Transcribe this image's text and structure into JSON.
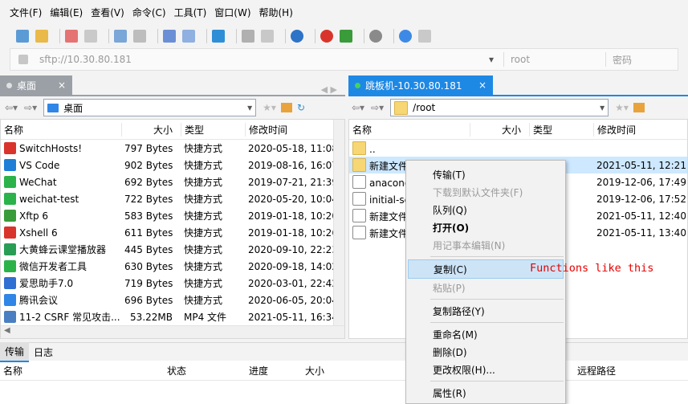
{
  "menu": [
    "文件(F)",
    "编辑(E)",
    "查看(V)",
    "命令(C)",
    "工具(T)",
    "窗口(W)",
    "帮助(H)"
  ],
  "address": {
    "url": "sftp://10.30.80.181",
    "user": "root",
    "password_placeholder": "密码"
  },
  "left": {
    "tab": "桌面",
    "path": "桌面",
    "columns": [
      "名称",
      "大小",
      "类型",
      "修改时间"
    ],
    "files": [
      {
        "name": "SwitchHosts!",
        "size": "797 Bytes",
        "type": "快捷方式",
        "modified": "2020-05-18, 11:08",
        "color": "#d9342b"
      },
      {
        "name": "VS Code",
        "size": "902 Bytes",
        "type": "快捷方式",
        "modified": "2019-08-16, 16:07",
        "color": "#1f7fd6"
      },
      {
        "name": "WeChat",
        "size": "692 Bytes",
        "type": "快捷方式",
        "modified": "2019-07-21, 21:39",
        "color": "#2bb34a"
      },
      {
        "name": "weichat-test",
        "size": "722 Bytes",
        "type": "快捷方式",
        "modified": "2020-05-20, 10:04",
        "color": "#2bb34a"
      },
      {
        "name": "Xftp 6",
        "size": "583 Bytes",
        "type": "快捷方式",
        "modified": "2019-01-18, 10:20",
        "color": "#3a9b3a"
      },
      {
        "name": "Xshell 6",
        "size": "611 Bytes",
        "type": "快捷方式",
        "modified": "2019-01-18, 10:26",
        "color": "#d9342b"
      },
      {
        "name": "大黄蜂云课堂播放器",
        "size": "445 Bytes",
        "type": "快捷方式",
        "modified": "2020-09-10, 22:23",
        "color": "#2a9d55"
      },
      {
        "name": "微信开发者工具",
        "size": "630 Bytes",
        "type": "快捷方式",
        "modified": "2020-09-18, 14:02",
        "color": "#2bb34a"
      },
      {
        "name": "爱思助手7.0",
        "size": "719 Bytes",
        "type": "快捷方式",
        "modified": "2020-03-01, 22:42",
        "color": "#2f6fd1"
      },
      {
        "name": "腾讯会议",
        "size": "696 Bytes",
        "type": "快捷方式",
        "modified": "2020-06-05, 20:04",
        "color": "#2f86e6"
      },
      {
        "name": "11-2 CSRF 常见攻击...",
        "size": "53.22MB",
        "type": "MP4 文件",
        "modified": "2021-05-11, 16:34",
        "color": "#4a7fc1"
      }
    ]
  },
  "right": {
    "tab": "跳板机-10.30.80.181",
    "path": "/root",
    "columns": [
      "名称",
      "大小",
      "类型",
      "修改时间"
    ],
    "files": [
      {
        "name": "..",
        "size": "",
        "type": "",
        "modified": "",
        "icon": "folder"
      },
      {
        "name": "新建文件夹",
        "size": "",
        "type": "文件夹",
        "modified": "2021-05-11, 12:21",
        "icon": "folder"
      },
      {
        "name": "anaconda",
        "size": "",
        "type": "件",
        "modified": "2019-12-06, 17:49",
        "icon": "doc"
      },
      {
        "name": "initial-se",
        "size": "",
        "type": "件",
        "modified": "2019-12-06, 17:52",
        "icon": "doc"
      },
      {
        "name": "新建文件",
        "size": "",
        "type": "",
        "modified": "2021-05-11, 12:40",
        "icon": "doc"
      },
      {
        "name": "新建文件",
        "size": "",
        "type": "档",
        "modified": "2021-05-11, 13:40",
        "icon": "doc"
      }
    ]
  },
  "context_menu": [
    {
      "label": "传输(T)",
      "state": "normal"
    },
    {
      "label": "下载到默认文件夹(F)",
      "state": "disabled"
    },
    {
      "label": "队列(Q)",
      "state": "normal"
    },
    {
      "label": "打开(O)",
      "state": "bold"
    },
    {
      "label": "用记事本编辑(N)",
      "state": "disabled"
    },
    {
      "sep": true
    },
    {
      "label": "复制(C)",
      "state": "highlight"
    },
    {
      "label": "粘贴(P)",
      "state": "disabled"
    },
    {
      "sep": true
    },
    {
      "label": "复制路径(Y)",
      "state": "normal"
    },
    {
      "sep": true
    },
    {
      "label": "重命名(M)",
      "state": "normal"
    },
    {
      "label": "删除(D)",
      "state": "normal"
    },
    {
      "label": "更改权限(H)...",
      "state": "normal"
    },
    {
      "sep": true
    },
    {
      "label": "属性(R)",
      "state": "normal"
    }
  ],
  "annotation": "Functions like this",
  "bottom": {
    "tabs": [
      "传输",
      "日志"
    ],
    "columns": [
      "名称",
      "状态",
      "进度",
      "大小",
      "远程路径"
    ]
  },
  "colors": {
    "accent_tab": "#1e88e5",
    "selection": "#cde8ff",
    "annotation": "#e60000"
  }
}
